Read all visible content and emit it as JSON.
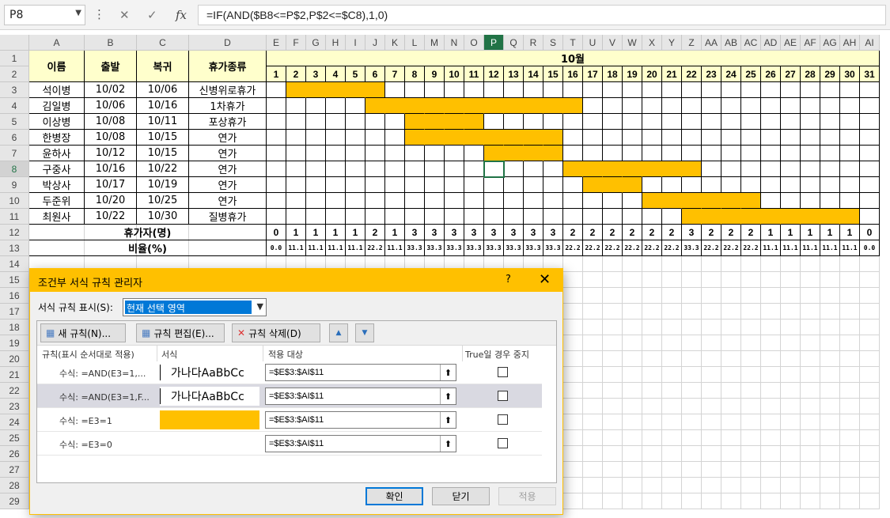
{
  "formula_bar": {
    "name_box": "P8",
    "formula": "=IF(AND($B8<=P$2,P$2<=$C8),1,0)",
    "cancel_icon": "✕",
    "enter_icon": "✓",
    "fx_label": "fx"
  },
  "columns": [
    "A",
    "B",
    "C",
    "D",
    "E",
    "F",
    "G",
    "H",
    "I",
    "J",
    "K",
    "L",
    "M",
    "N",
    "O",
    "P",
    "Q",
    "R",
    "S",
    "T",
    "U",
    "V",
    "W",
    "X",
    "Y",
    "Z",
    "AA",
    "AB",
    "AC",
    "AD",
    "AE",
    "AF",
    "AG",
    "AH",
    "AI"
  ],
  "selected_column": "P",
  "selected_row": 8,
  "headers": {
    "name": "이름",
    "depart": "출발",
    "return": "복귀",
    "leave_type": "휴가종류",
    "month": "10월"
  },
  "days": [
    "1",
    "2",
    "3",
    "4",
    "5",
    "6",
    "7",
    "8",
    "9",
    "10",
    "11",
    "12",
    "13",
    "14",
    "15",
    "16",
    "17",
    "18",
    "19",
    "20",
    "21",
    "22",
    "23",
    "24",
    "25",
    "26",
    "27",
    "28",
    "29",
    "30",
    "31"
  ],
  "rows": [
    {
      "name": "석이병",
      "depart": "10/02",
      "return": "10/06",
      "type": "신병위로휴가",
      "start": 2,
      "end": 6
    },
    {
      "name": "김일병",
      "depart": "10/06",
      "return": "10/16",
      "type": "1차휴가",
      "start": 6,
      "end": 16
    },
    {
      "name": "이상병",
      "depart": "10/08",
      "return": "10/11",
      "type": "포상휴가",
      "start": 8,
      "end": 11
    },
    {
      "name": "한병장",
      "depart": "10/08",
      "return": "10/15",
      "type": "연가",
      "start": 8,
      "end": 15
    },
    {
      "name": "윤하사",
      "depart": "10/12",
      "return": "10/15",
      "type": "연가",
      "start": 12,
      "end": 15
    },
    {
      "name": "구중사",
      "depart": "10/16",
      "return": "10/22",
      "type": "연가",
      "start": 16,
      "end": 22
    },
    {
      "name": "박상사",
      "depart": "10/17",
      "return": "10/19",
      "type": "연가",
      "start": 17,
      "end": 19
    },
    {
      "name": "두준위",
      "depart": "10/20",
      "return": "10/25",
      "type": "연가",
      "start": 20,
      "end": 25
    },
    {
      "name": "최원사",
      "depart": "10/22",
      "return": "10/30",
      "type": "질병휴가",
      "start": 22,
      "end": 30
    }
  ],
  "count_label": "휴가자(명)",
  "counts": [
    "0",
    "1",
    "1",
    "1",
    "1",
    "2",
    "1",
    "3",
    "3",
    "3",
    "3",
    "3",
    "3",
    "3",
    "3",
    "2",
    "2",
    "2",
    "2",
    "2",
    "2",
    "3",
    "2",
    "2",
    "2",
    "1",
    "1",
    "1",
    "1",
    "1",
    "0"
  ],
  "ratio_label": "비율(%)",
  "ratios": [
    "0.0",
    "11.1",
    "11.1",
    "11.1",
    "11.1",
    "22.2",
    "11.1",
    "33.3",
    "33.3",
    "33.3",
    "33.3",
    "33.3",
    "33.3",
    "33.3",
    "33.3",
    "22.2",
    "22.2",
    "22.2",
    "22.2",
    "22.2",
    "22.2",
    "33.3",
    "22.2",
    "22.2",
    "22.2",
    "11.1",
    "11.1",
    "11.1",
    "11.1",
    "11.1",
    "0.0"
  ],
  "extra_rows": [
    "14",
    "15",
    "16",
    "17",
    "18",
    "19",
    "20",
    "21",
    "22",
    "23",
    "24",
    "25",
    "26",
    "27",
    "28",
    "29"
  ],
  "dialog": {
    "title": "조건부 서식 규칙 관리자",
    "help": "?",
    "close": "✕",
    "show_label": "서식 규칙 표시(S):",
    "show_value": "현재 선택 영역",
    "new_rule": "새 규칙(N)...",
    "edit_rule": "규칙 편집(E)...",
    "delete_rule": "규칙 삭제(D)",
    "up": "▲",
    "down": "▼",
    "col_rule": "규칙(표시 순서대로 적용)",
    "col_format": "서식",
    "col_applies": "적용 대상",
    "col_stop": "True일 경우 중지",
    "rules": [
      {
        "name": "수식: =AND(E3=1,...",
        "preview": "가나다AaBbCc",
        "fill": false,
        "applies": "=$E$3:$AI$11"
      },
      {
        "name": "수식: =AND(E3=1,F...",
        "preview": "가나다AaBbCc",
        "fill": false,
        "applies": "=$E$3:$AI$11"
      },
      {
        "name": "수식: =E3=1",
        "preview": "",
        "fill": true,
        "applies": "=$E$3:$AI$11"
      },
      {
        "name": "수식: =E3=0",
        "preview": "",
        "fill": false,
        "applies": "=$E$3:$AI$11"
      }
    ],
    "ok": "확인",
    "close_btn": "닫기",
    "apply": "적용"
  },
  "colors": {
    "bar": "#ffc000",
    "header_fill": "#ffffcc",
    "selection": "#217346"
  }
}
